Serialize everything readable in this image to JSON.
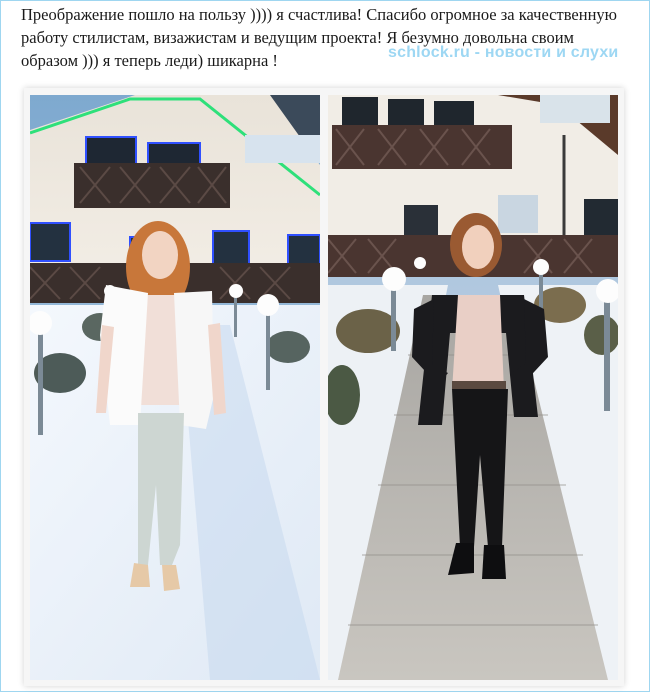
{
  "post": {
    "caption": "Преображение пошло на пользу )))) я счастлива! Спасибо огромное за качественную работу стилистам, визажистам и ведущим проекта! Я безумно довольна своим образом ))) я теперь леди) шикарна !",
    "watermark": "schlock.ru - новости и слухи"
  },
  "photos": [
    {
      "subject": "woman-white-fur-vest"
    },
    {
      "subject": "woman-black-jacket"
    }
  ],
  "colors": {
    "caption_text": "#1a1a1a",
    "watermark": "#9dd7f3",
    "frame_border": "#9fd6f0"
  }
}
